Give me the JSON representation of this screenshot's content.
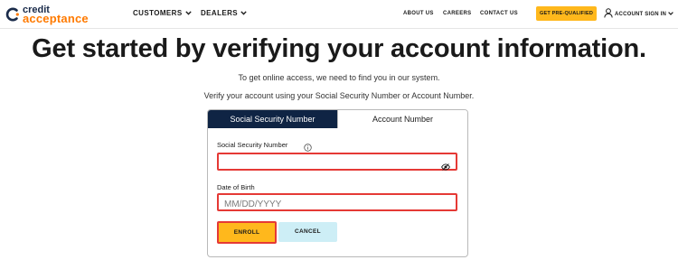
{
  "brand": {
    "line1": "credit",
    "line2": "acceptance",
    "colors": {
      "navy": "#1a2b4a",
      "orange": "#ff7a00",
      "yellow": "#ffb81c",
      "tab_active": "#0f2444",
      "error": "#e53935",
      "cancel_bg": "#cdeef6"
    }
  },
  "nav": {
    "customers": "CUSTOMERS",
    "dealers": "DEALERS",
    "about": "ABOUT US",
    "careers": "CAREERS",
    "contact": "CONTACT US",
    "prequal": "GET PRE-QUALIFIED",
    "account": "ACCOUNT SIGN IN"
  },
  "page": {
    "headline": "Get started by verifying your account information.",
    "intro": "To get online access, we need to find you in our system.",
    "instruction": "Verify your account using your Social Security Number or Account Number."
  },
  "tabs": [
    {
      "label": "Social Security Number",
      "active": true
    },
    {
      "label": "Account Number",
      "active": false
    }
  ],
  "form": {
    "ssn_label": "Social Security Number",
    "ssn_value": "",
    "dob_label": "Date of Birth",
    "dob_placeholder": "MM/DD/YYYY",
    "dob_value": "",
    "enroll": "ENROLL",
    "cancel": "CANCEL"
  },
  "icons": {
    "logo": "credit-acceptance-logo",
    "chevron": "chevron-down-icon",
    "user": "user-icon",
    "info": "info-icon",
    "eye": "eye-slash-icon"
  }
}
